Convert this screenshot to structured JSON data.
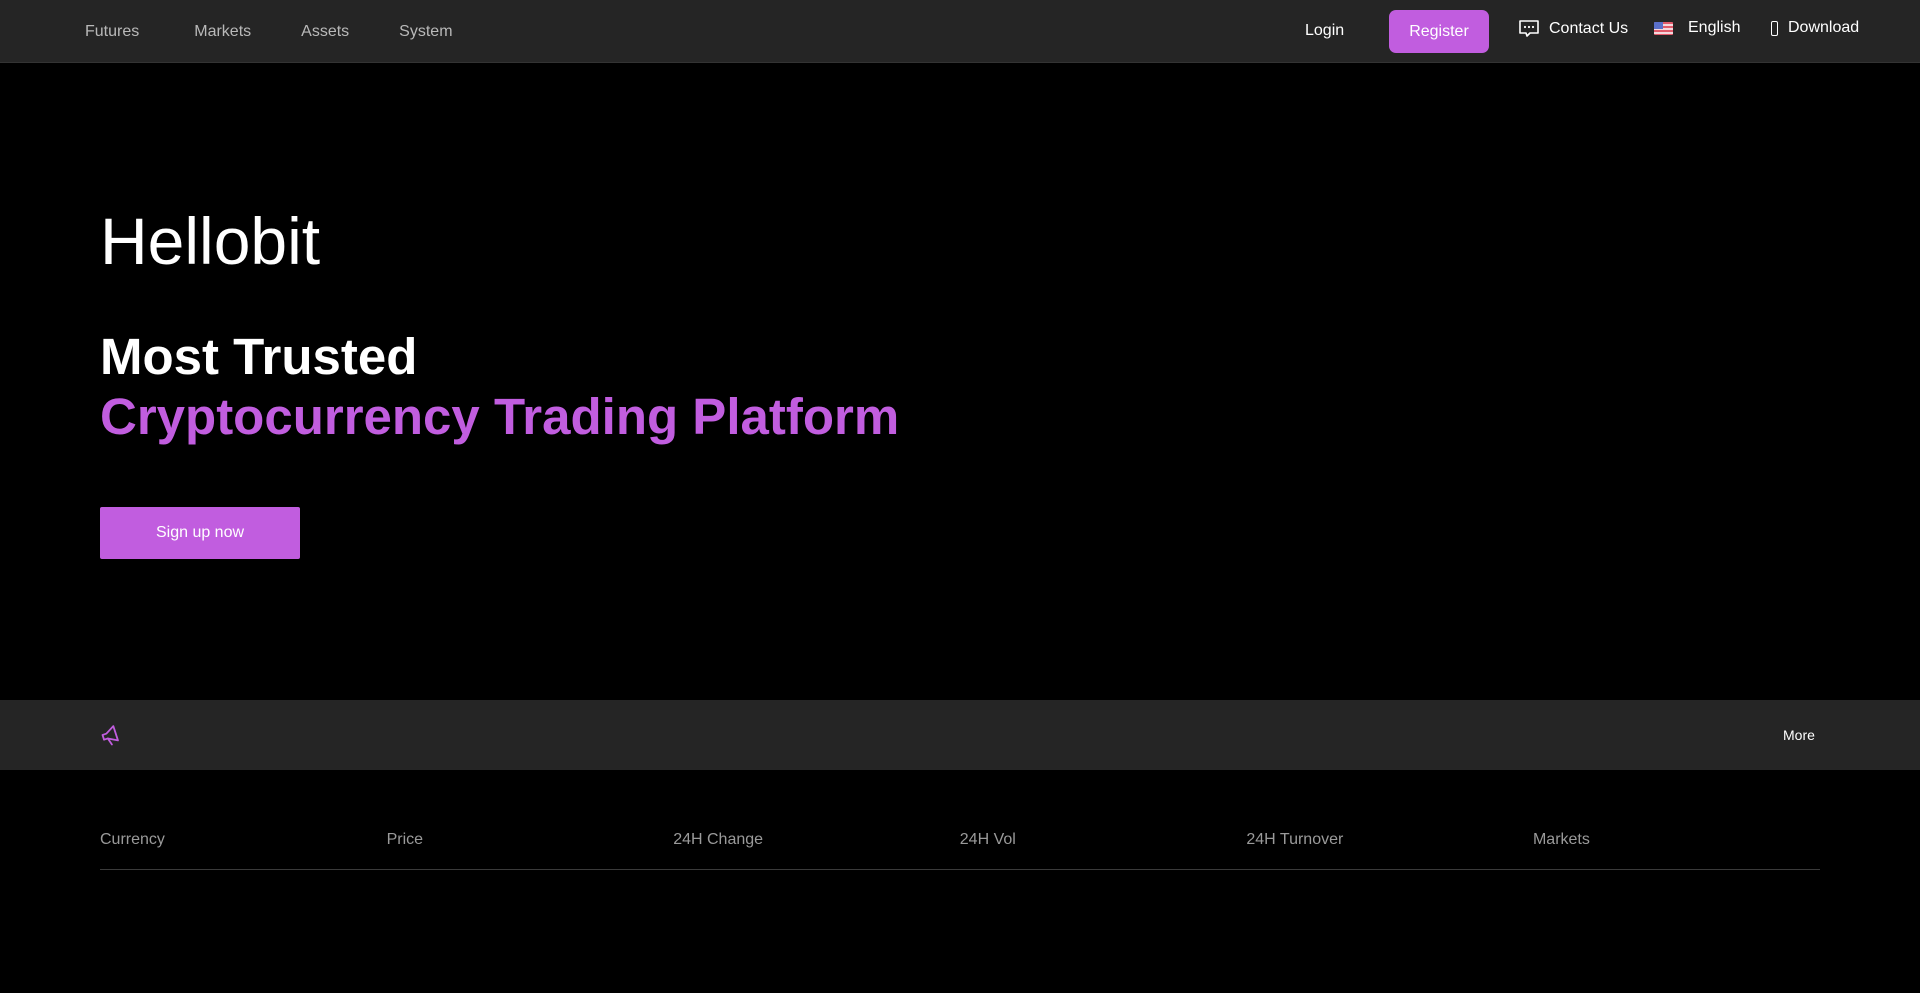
{
  "nav": {
    "left_items": [
      {
        "label": "Futures",
        "has_caret": true
      },
      {
        "label": "Markets",
        "has_caret": false
      },
      {
        "label": "Assets",
        "has_caret": false
      },
      {
        "label": "System",
        "has_caret": true
      }
    ],
    "caret_glyph": "",
    "login_label": "Login",
    "register_label": "Register",
    "contact_label": "Contact Us",
    "language_label": "English",
    "download_label": "Download"
  },
  "hero": {
    "brand": "Hellobit",
    "headline_line1": "Most Trusted",
    "headline_line2": "Cryptocurrency Trading Platform",
    "cta_label": "Sign up now"
  },
  "announcement": {
    "more_label": "More",
    "more_glyph": ""
  },
  "market_table": {
    "columns": [
      "Currency",
      "Price",
      "24H Change",
      "24H Vol",
      "24H Turnover",
      "Markets"
    ]
  },
  "colors": {
    "accent": "#c15ddf",
    "nav_bg": "#252525",
    "page_bg": "#000000"
  },
  "icons": {
    "contact": "chat-bubble-icon",
    "language": "us-flag-icon",
    "download": "phone-icon",
    "announcement": "megaphone-icon",
    "caret": "chevron-down-icon"
  }
}
